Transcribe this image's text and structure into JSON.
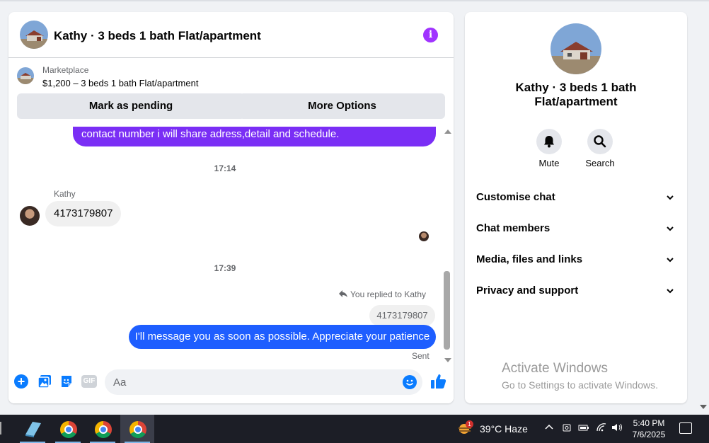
{
  "chat": {
    "title": "Kathy · 3 beds 1 bath Flat/apartment",
    "marketplace_label": "Marketplace",
    "listing": "$1,200 – 3 beds 1 bath Flat/apartment",
    "mark_pending": "Mark as pending",
    "more_options": "More Options",
    "messages": {
      "top_bubble": "contact number i will share adress,detail and schedule.",
      "time1": "17:14",
      "sender": "Kathy",
      "incoming": "4173179807",
      "time2": "17:39",
      "replied": "You replied to Kathy",
      "quoted": "4173179807",
      "outgoing": "I'll message you as soon as possible. Appreciate your patience",
      "status": "Sent"
    },
    "composer": {
      "placeholder": "Aa",
      "gif": "GIF"
    }
  },
  "sidebar": {
    "title": "Kathy · 3 beds 1 bath Flat/apartment",
    "mute": "Mute",
    "search": "Search",
    "sections": [
      "Customise chat",
      "Chat members",
      "Media, files and links",
      "Privacy and support"
    ]
  },
  "watermark": {
    "line1": "Activate Windows",
    "line2": "Go to Settings to activate Windows."
  },
  "taskbar": {
    "weather_badge": "1",
    "weather": "39°C  Haze",
    "time": "5:40 PM",
    "date": "7/6/2025"
  },
  "colors": {
    "purple_bubble": "#7a2ef5",
    "blue_bubble": "#1e5eff",
    "messenger_blue": "#0a7cff",
    "info_purple": "#a033ff"
  }
}
